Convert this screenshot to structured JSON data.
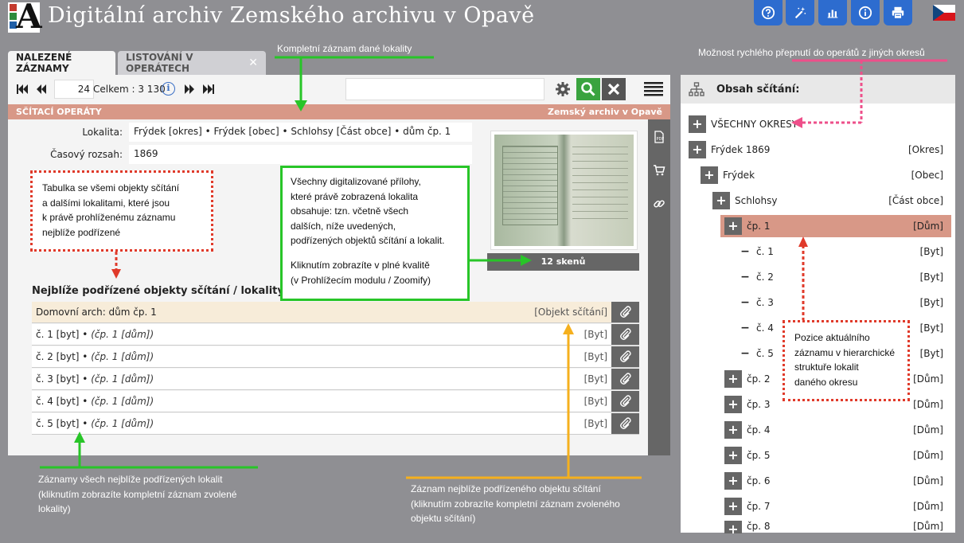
{
  "app": {
    "logo_letter": "A",
    "title": "Digitální archiv  Zemského archivu v Opavě"
  },
  "header_buttons": [
    {
      "icon": "help-icon"
    },
    {
      "icon": "magic-wand-icon"
    },
    {
      "icon": "bar-chart-icon"
    },
    {
      "icon": "info-icon"
    },
    {
      "icon": "printer-icon"
    }
  ],
  "language": {
    "flag": "cz-flag-icon"
  },
  "tabs": [
    {
      "label": "NALEZENÉ ZÁZNAMY",
      "active": true
    },
    {
      "label": "LISTOVÁNÍ V OPERÁTECH",
      "close": "✕"
    }
  ],
  "toolbar": {
    "page": "24",
    "total_label": "Celkem : 3 130",
    "info_glyph": "i",
    "search_value": ""
  },
  "section": {
    "title": "SČÍTACÍ OPERÁTY",
    "archive": "Zemský archiv v Opavě"
  },
  "record": {
    "lokalita_label": "Lokalita:",
    "lokalita_value": "Frýdek [okres] • Frýdek [obec] • Schlohsy [Část obce] • dům čp. 1",
    "rozsah_label": "Časový rozsah:",
    "rozsah_value": "1869",
    "scans_caption": "12 skenů"
  },
  "subordinate": {
    "heading": "Nejblíže podřízené objekty sčítání / lokality:",
    "rows": [
      {
        "name": "Domovní arch: dům čp. 1",
        "sub": "",
        "type": "[Objekt sčítání]"
      },
      {
        "name": "č. 1 [byt] • ",
        "sub": "(čp. 1 [dům])",
        "type": "[Byt]"
      },
      {
        "name": "č. 2 [byt] • ",
        "sub": "(čp. 1 [dům])",
        "type": "[Byt]"
      },
      {
        "name": "č. 3 [byt] • ",
        "sub": "(čp. 1 [dům])",
        "type": "[Byt]"
      },
      {
        "name": "č. 4 [byt] • ",
        "sub": "(čp. 1 [dům])",
        "type": "[Byt]"
      },
      {
        "name": "č. 5 [byt] • ",
        "sub": "(čp. 1 [dům])",
        "type": "[Byt]"
      }
    ]
  },
  "tree": {
    "header": "Obsah sčítání:",
    "items": [
      {
        "label": "VŠECHNY OKRESY",
        "type": "",
        "marker": "+"
      },
      {
        "label": "Frýdek 1869",
        "type": "[Okres]",
        "marker": "+"
      },
      {
        "label": "Frýdek",
        "type": "[Obec]",
        "marker": "+"
      },
      {
        "label": "Schlohsy",
        "type": "[Část obce]",
        "marker": "+"
      },
      {
        "label": "čp. 1",
        "type": "[Dům]",
        "marker": "+"
      },
      {
        "label": "č. 1",
        "type": "[Byt]",
        "marker": "−"
      },
      {
        "label": "č. 2",
        "type": "[Byt]",
        "marker": "−"
      },
      {
        "label": "č. 3",
        "type": "[Byt]",
        "marker": "−"
      },
      {
        "label": "č. 4",
        "type": "[Byt]",
        "marker": "−"
      },
      {
        "label": "č. 5",
        "type": "[Byt]",
        "marker": "−"
      },
      {
        "label": "čp. 2",
        "type": "[Dům]",
        "marker": "+"
      },
      {
        "label": "čp. 3",
        "type": "[Dům]",
        "marker": "+"
      },
      {
        "label": "čp. 4",
        "type": "[Dům]",
        "marker": "+"
      },
      {
        "label": "čp. 5",
        "type": "[Dům]",
        "marker": "+"
      },
      {
        "label": "čp. 6",
        "type": "[Dům]",
        "marker": "+"
      },
      {
        "label": "čp. 7",
        "type": "[Dům]",
        "marker": "+"
      },
      {
        "label": "čp. 8",
        "type": "[Dům]",
        "marker": "+"
      }
    ]
  },
  "annotations": {
    "top_center": "Kompletní záznam dané lokality",
    "top_right": "Možnost rychlého přepnutí do operátů z jiných okresů",
    "table_note": [
      "Tabulka se všemi objekty sčítání",
      "a dalšími lokalitami, které jsou",
      "k právě prohlíženému záznamu",
      "nejblíže podřízené"
    ],
    "attachments_note": [
      "Všechny digitalizované přílohy,",
      "které právě zobrazená lokalita",
      "obsahuje: tzn. včetně všech",
      "dalších, níže uvedených,",
      "podřízených objektů sčítání a lokalit.",
      "",
      "Kliknutím zobrazíte v plné kvalitě",
      "(v Prohlížecím modulu / Zoomify)"
    ],
    "position_note": [
      "Pozice aktuálního",
      "záznamu v hierarchické",
      "struktuře lokalit",
      "daného okresu"
    ],
    "bottom_left": [
      "Záznamy všech nejblíže podřízených lokalit",
      "(kliknutím zobrazíte kompletní záznam zvolené",
      "lokality)"
    ],
    "bottom_center": [
      "Záznam nejblíže podřízeného objektu sčítání",
      "(kliknutím zobrazíte kompletní záznam zvoleného",
      "objektu sčítání)"
    ]
  },
  "colors": {
    "background": "#8f8f93",
    "header_button": "#2d6ccf",
    "section_bar": "#d89887",
    "search_button": "#3aa33f",
    "annotation_green": "#28c528",
    "annotation_red": "#e03a2a",
    "annotation_pink": "#ee4f8a",
    "annotation_orange": "#f5b01e"
  }
}
